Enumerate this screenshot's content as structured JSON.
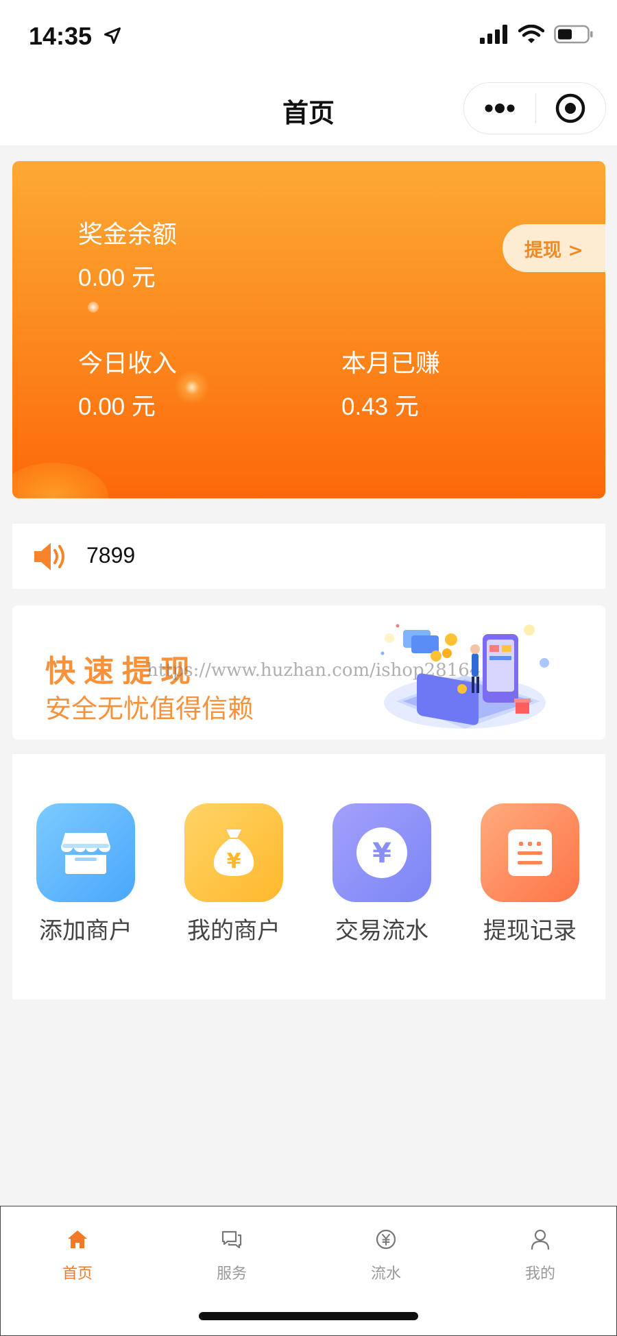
{
  "status_bar": {
    "time": "14:35",
    "icons": [
      "location-arrow-icon",
      "signal-icon",
      "wifi-icon",
      "battery-icon"
    ]
  },
  "nav": {
    "title": "首页",
    "icons": [
      "more-dots-icon",
      "target-icon"
    ]
  },
  "balance_card": {
    "bonus_label": "奖金余额",
    "bonus_value": "0.00 元",
    "today_label": "今日收入",
    "today_value": "0.00 元",
    "month_label": "本月已赚",
    "month_value": "0.43 元",
    "withdraw_label": "提现 >",
    "colors": {
      "top": "#fda934",
      "bottom": "#fd6809"
    }
  },
  "notice": {
    "icon": "speaker-icon",
    "text": "7899"
  },
  "banner": {
    "title": "快速提现",
    "subtitle": "安全无忧值得信赖",
    "watermark": "https://www.huzhan.com/ishop28164",
    "accent": "#f7923b"
  },
  "menu": [
    {
      "label": "添加商户",
      "icon": "store-icon",
      "color": "#56b6fb"
    },
    {
      "label": "我的商户",
      "icon": "money-bag-icon",
      "color": "#ffc237"
    },
    {
      "label": "交易流水",
      "icon": "yen-circle-icon",
      "color": "#8a8ff8"
    },
    {
      "label": "提现记录",
      "icon": "record-icon",
      "color": "#fd8656"
    }
  ],
  "tabs": [
    {
      "label": "首页",
      "icon": "home-icon",
      "active": true
    },
    {
      "label": "服务",
      "icon": "chat-icon",
      "active": false
    },
    {
      "label": "流水",
      "icon": "yen-icon",
      "active": false
    },
    {
      "label": "我的",
      "icon": "user-icon",
      "active": false
    }
  ]
}
